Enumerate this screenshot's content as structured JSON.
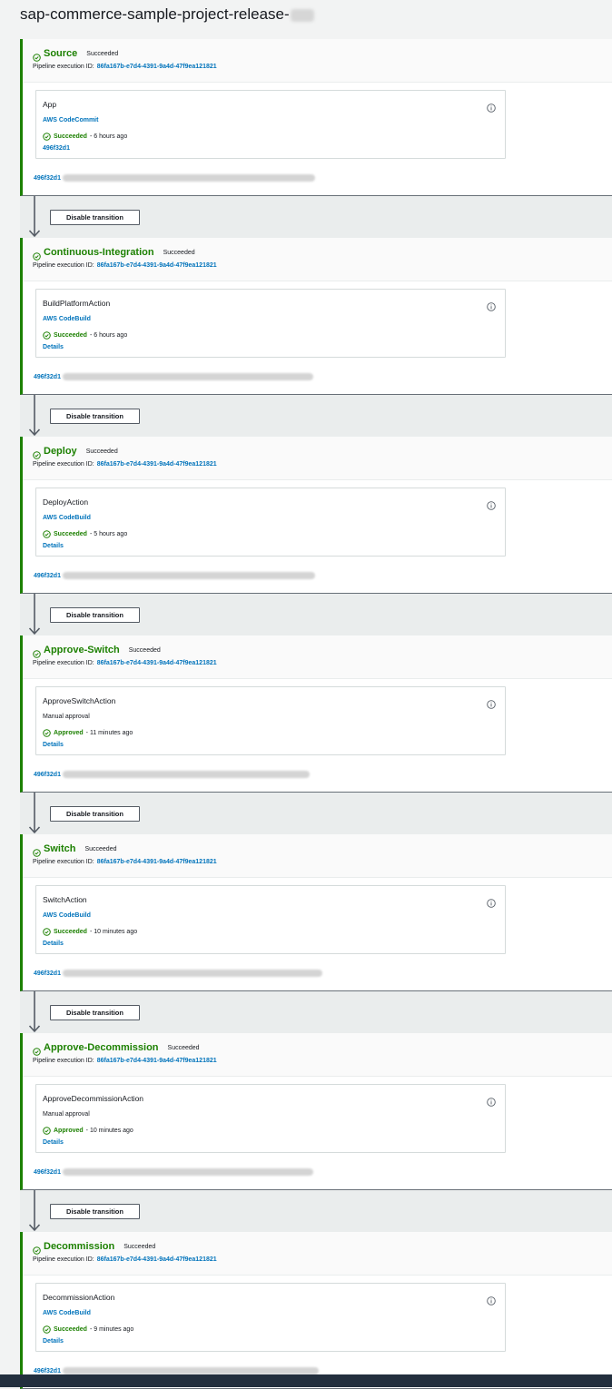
{
  "page": {
    "title": "sap-commerce-sample-project-release-"
  },
  "labels": {
    "execution_id_label": "Pipeline execution ID:",
    "execution_id": "86fa167b-e7d4-4391-9a4d-47f9ea121821",
    "transition_button": "Disable transition"
  },
  "colors": {
    "success": "#1d8102",
    "link": "#0073bb",
    "border": "#d5dbdb"
  },
  "stages": [
    {
      "name": "Source",
      "status": "Succeeded",
      "action": {
        "name": "App",
        "provider": "AWS CodeCommit",
        "provider_is_link": true,
        "status": "Succeeded",
        "time": "6 hours ago",
        "link": "496f32d1"
      },
      "commit_id": "496f32d1"
    },
    {
      "name": "Continuous-Integration",
      "status": "Succeeded",
      "action": {
        "name": "BuildPlatformAction",
        "provider": "AWS CodeBuild",
        "provider_is_link": true,
        "status": "Succeeded",
        "time": "6 hours ago",
        "link": "Details"
      },
      "commit_id": "496f32d1"
    },
    {
      "name": "Deploy",
      "status": "Succeeded",
      "action": {
        "name": "DeployAction",
        "provider": "AWS CodeBuild",
        "provider_is_link": true,
        "status": "Succeeded",
        "time": "5 hours ago",
        "link": "Details"
      },
      "commit_id": "496f32d1"
    },
    {
      "name": "Approve-Switch",
      "status": "Succeeded",
      "action": {
        "name": "ApproveSwitchAction",
        "provider": "Manual approval",
        "provider_is_link": false,
        "status": "Approved",
        "time": "11 minutes ago",
        "link": "Details"
      },
      "commit_id": "496f32d1"
    },
    {
      "name": "Switch",
      "status": "Succeeded",
      "action": {
        "name": "SwitchAction",
        "provider": "AWS CodeBuild",
        "provider_is_link": true,
        "status": "Succeeded",
        "time": "10 minutes ago",
        "link": "Details"
      },
      "commit_id": "496f32d1"
    },
    {
      "name": "Approve-Decommission",
      "status": "Succeeded",
      "action": {
        "name": "ApproveDecommissionAction",
        "provider": "Manual approval",
        "provider_is_link": false,
        "status": "Approved",
        "time": "10 minutes ago",
        "link": "Details"
      },
      "commit_id": "496f32d1"
    },
    {
      "name": "Decommission",
      "status": "Succeeded",
      "action": {
        "name": "DecommissionAction",
        "provider": "AWS CodeBuild",
        "provider_is_link": true,
        "status": "Succeeded",
        "time": "9 minutes ago",
        "link": "Details"
      },
      "commit_id": "496f32d1"
    }
  ]
}
